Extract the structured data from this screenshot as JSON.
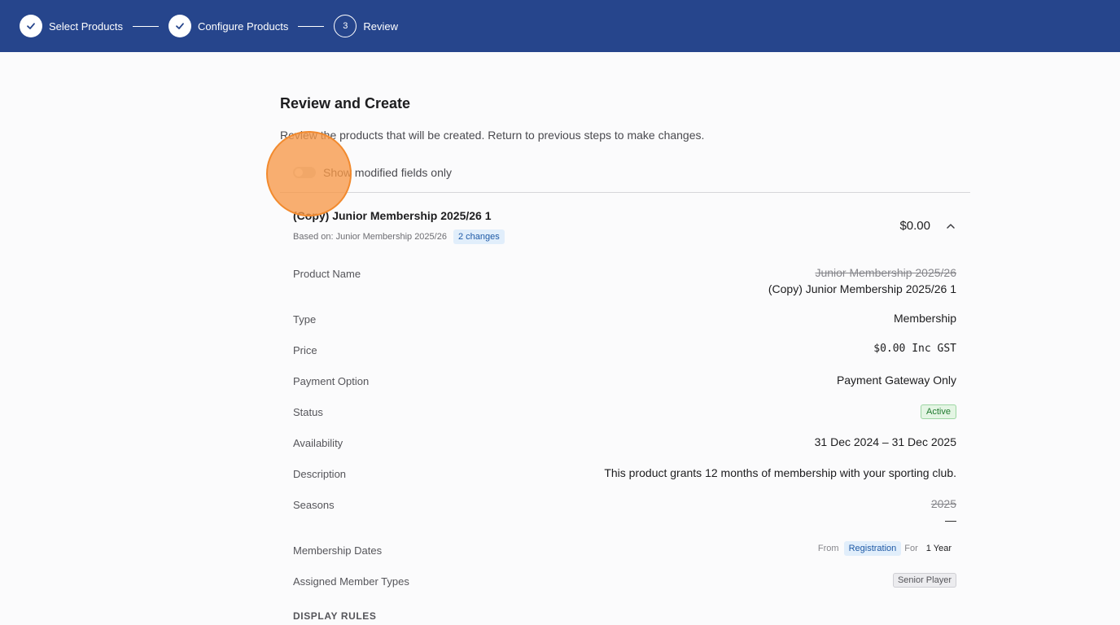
{
  "stepper": {
    "steps": [
      {
        "label": "Select Products",
        "state": "done"
      },
      {
        "label": "Configure Products",
        "state": "done"
      },
      {
        "label": "Review",
        "state": "current",
        "number": "3"
      }
    ]
  },
  "page": {
    "title": "Review and Create",
    "subtitle": "Review the products that will be created. Return to previous steps to make changes."
  },
  "toggle": {
    "label": "Show modified fields only",
    "checked": false
  },
  "product": {
    "title": "(Copy) Junior Membership 2025/26 1",
    "based_on": "Based on: Junior Membership 2025/26",
    "changes_badge": "2 changes",
    "price": "$0.00",
    "fields": {
      "product_name": {
        "label": "Product Name",
        "old": "Junior Membership 2025/26",
        "new": "(Copy) Junior Membership 2025/26 1"
      },
      "type": {
        "label": "Type",
        "value": "Membership"
      },
      "price": {
        "label": "Price",
        "value": "$0.00 Inc GST"
      },
      "payment_option": {
        "label": "Payment Option",
        "value": "Payment Gateway Only"
      },
      "status": {
        "label": "Status",
        "value": "Active"
      },
      "availability": {
        "label": "Availability",
        "value": "31 Dec 2024 – 31 Dec 2025"
      },
      "description": {
        "label": "Description",
        "value": "This product grants 12 months of membership with your sporting club."
      },
      "seasons": {
        "label": "Seasons",
        "old": "2025",
        "new": "—"
      },
      "membership_dates": {
        "label": "Membership Dates",
        "from_label": "From",
        "from_value": "Registration",
        "for_label": "For",
        "for_value": "1 Year"
      },
      "assigned_member_types": {
        "label": "Assigned Member Types",
        "value": "Senior Player"
      }
    },
    "display_rules_heading": "DISPLAY RULES"
  },
  "colors": {
    "header_bg": "#26458c",
    "accent_badge": "#e1eefb",
    "status_active": "#1f7a2e",
    "cursor_halo": "#f7a058"
  }
}
